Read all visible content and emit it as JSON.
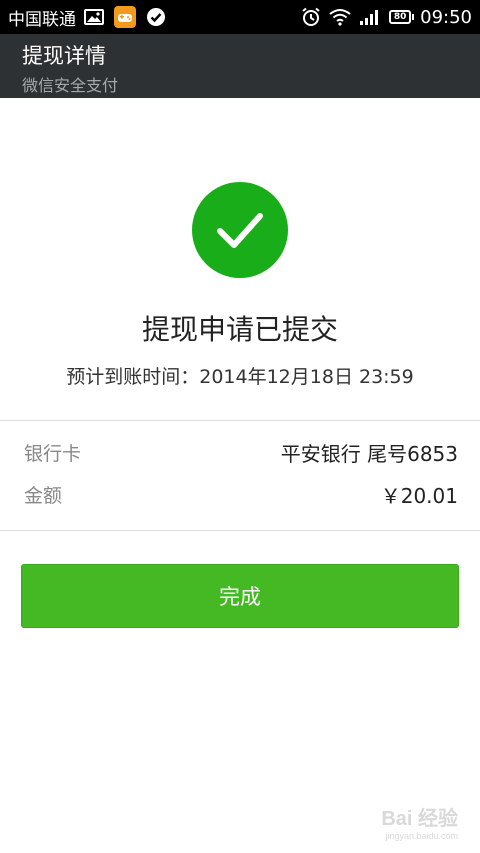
{
  "status_bar": {
    "carrier": "中国联通",
    "battery": "80",
    "time": "09:50",
    "icons": [
      "image-icon",
      "game-icon",
      "check-circle-icon",
      "alarm-icon",
      "wifi-icon",
      "signal-icon",
      "battery-icon"
    ]
  },
  "header": {
    "title": "提现详情",
    "subtitle": "微信安全支付"
  },
  "result": {
    "icon": "checkmark-icon",
    "title": "提现申请已提交",
    "eta": "预计到账时间：2014年12月18日 23:59"
  },
  "details": [
    {
      "label": "银行卡",
      "value": "平安银行 尾号6853"
    },
    {
      "label": "金额",
      "value": "￥20.01"
    }
  ],
  "actions": {
    "done_label": "完成"
  },
  "watermark": {
    "main": "Bai 经验",
    "sub": "jingyan.baidu.com"
  },
  "colors": {
    "status_bar_bg": "#000000",
    "header_bg": "#2d3133",
    "success_green": "#19ad19",
    "button_green": "#44b924"
  }
}
